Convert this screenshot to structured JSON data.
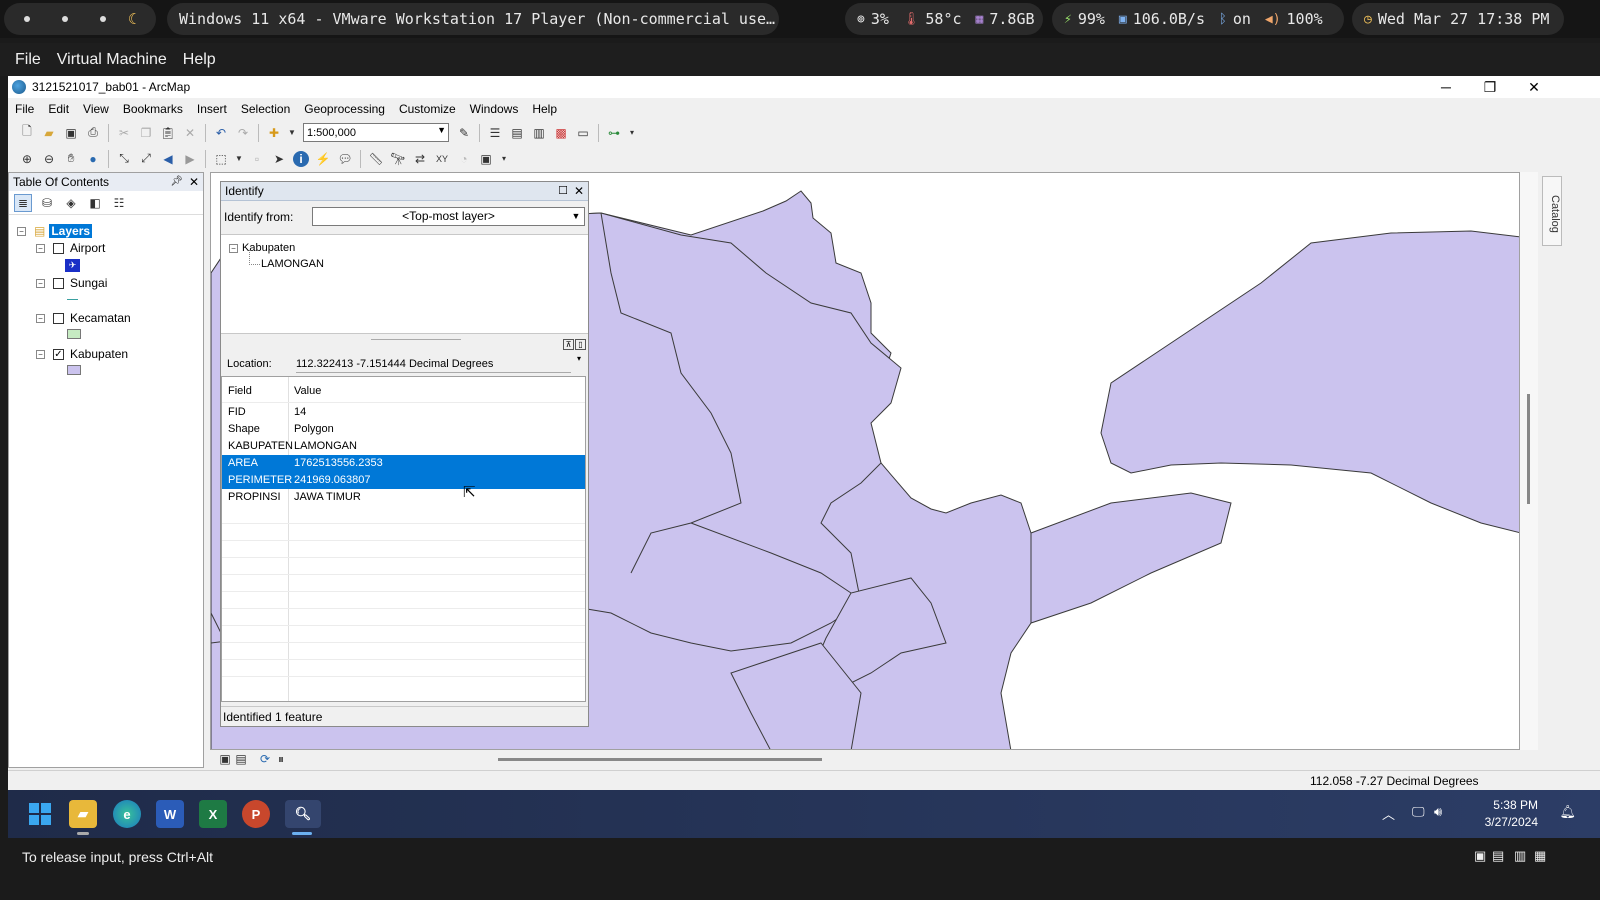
{
  "topbar": {
    "window_title": "Windows 11 x64 - VMware Workstation 17 Player (Non-commercial use…",
    "cpu": "3%",
    "temp": "58°c",
    "mem": "7.8GB",
    "battery": "99%",
    "net": "106.0B/s",
    "bluetooth": "on",
    "volume": "100%",
    "datetime": "Wed Mar 27 17:38 PM"
  },
  "vmware_menu": [
    "File",
    "Virtual Machine",
    "Help"
  ],
  "arcmap": {
    "title": "3121521017_bab01 - ArcMap",
    "menu": [
      "File",
      "Edit",
      "View",
      "Bookmarks",
      "Insert",
      "Selection",
      "Geoprocessing",
      "Customize",
      "Windows",
      "Help"
    ],
    "scale": "1:500,000",
    "statusbar_coords": "112.058  -7.27 Decimal Degrees",
    "catalog_tab": "Catalog"
  },
  "toc": {
    "title": "Table Of Contents",
    "root": "Layers",
    "layers": [
      {
        "name": "Airport",
        "checked": false
      },
      {
        "name": "Sungai",
        "checked": false
      },
      {
        "name": "Kecamatan",
        "checked": false
      },
      {
        "name": "Kabupaten",
        "checked": true
      }
    ]
  },
  "identify": {
    "title": "Identify",
    "from_label": "Identify from:",
    "from_value": "<Top-most layer>",
    "tree_layer": "Kabupaten",
    "tree_feature": "LAMONGAN",
    "location_label": "Location:",
    "location_value": "112.322413  -7.151444 Decimal Degrees",
    "col_field": "Field",
    "col_value": "Value",
    "rows": [
      {
        "field": "FID",
        "value": "14"
      },
      {
        "field": "Shape",
        "value": "Polygon"
      },
      {
        "field": "KABUPATEN",
        "value": "LAMONGAN"
      },
      {
        "field": "AREA",
        "value": "1762513556.2353"
      },
      {
        "field": "PERIMETER",
        "value": "241969.063807"
      },
      {
        "field": "PROPINSI",
        "value": "JAWA TIMUR"
      }
    ],
    "status": "Identified 1 feature"
  },
  "taskbar": {
    "time": "5:38 PM",
    "date": "3/27/2024"
  },
  "vm_hint": "To release input, press Ctrl+Alt",
  "colors": {
    "polygon_fill": "#cbc3ee",
    "selection": "#0078d7"
  }
}
